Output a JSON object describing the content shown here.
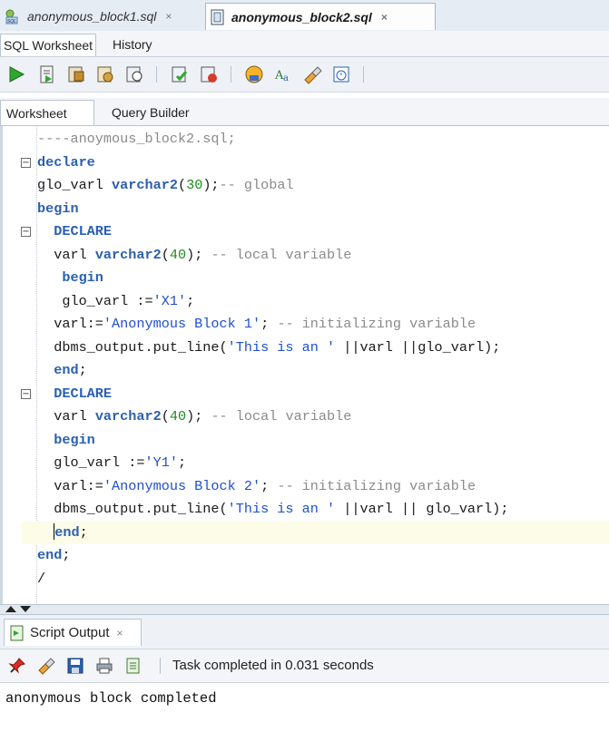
{
  "file_tabs": [
    {
      "label": "anonymous_block1.sql",
      "close": "×",
      "active": false
    },
    {
      "label": "anonymous_block2.sql",
      "close": "×",
      "active": true
    }
  ],
  "sub_tabs": {
    "worksheet": "SQL Worksheet",
    "history": "History"
  },
  "toolbar_icons": [
    "run-statement-icon",
    "run-script-icon",
    "autotrace-icon",
    "explain-plan-icon",
    "sql-tuning-icon",
    "commit-icon",
    "rollback-icon",
    "unshared-sql-icon",
    "to-upper-icon",
    "clear-icon",
    "sql-history-icon"
  ],
  "worksheet_tabs": {
    "worksheet": "Worksheet",
    "query_builder": "Query Builder"
  },
  "editor": {
    "lines": [
      [
        {
          "t": "----anoymous_block2.sql;",
          "c": "cm"
        }
      ],
      [
        {
          "t": "declare",
          "c": "kw"
        }
      ],
      [
        {
          "t": "glo_varl ",
          "c": ""
        },
        {
          "t": "varchar2",
          "c": "ty"
        },
        {
          "t": "(",
          "c": ""
        },
        {
          "t": "30",
          "c": "nm"
        },
        {
          "t": ");",
          "c": ""
        },
        {
          "t": "-- global",
          "c": "cm"
        }
      ],
      [
        {
          "t": "begin",
          "c": "kw"
        }
      ],
      [
        {
          "t": "  DECLARE",
          "c": "kw"
        }
      ],
      [
        {
          "t": "  varl ",
          "c": ""
        },
        {
          "t": "varchar2",
          "c": "ty"
        },
        {
          "t": "(",
          "c": ""
        },
        {
          "t": "40",
          "c": "nm"
        },
        {
          "t": "); ",
          "c": ""
        },
        {
          "t": "-- local variable",
          "c": "cm"
        }
      ],
      [
        {
          "t": "   begin",
          "c": "kw"
        }
      ],
      [
        {
          "t": "   glo_varl :=",
          "c": ""
        },
        {
          "t": "'X1'",
          "c": "st"
        },
        {
          "t": ";",
          "c": ""
        }
      ],
      [
        {
          "t": "  varl:=",
          "c": ""
        },
        {
          "t": "'Anonymous Block 1'",
          "c": "st"
        },
        {
          "t": "; ",
          "c": ""
        },
        {
          "t": "-- initializing variable",
          "c": "cm"
        }
      ],
      [
        {
          "t": "  dbms_output.put_line(",
          "c": ""
        },
        {
          "t": "'This is an '",
          "c": "st"
        },
        {
          "t": " ||varl ||glo_varl);",
          "c": ""
        }
      ],
      [
        {
          "t": "  end",
          "c": "kw"
        },
        {
          "t": ";",
          "c": ""
        }
      ],
      [
        {
          "t": "  DECLARE",
          "c": "kw"
        }
      ],
      [
        {
          "t": "  varl ",
          "c": ""
        },
        {
          "t": "varchar2",
          "c": "ty"
        },
        {
          "t": "(",
          "c": ""
        },
        {
          "t": "40",
          "c": "nm"
        },
        {
          "t": "); ",
          "c": ""
        },
        {
          "t": "-- local variable",
          "c": "cm"
        }
      ],
      [
        {
          "t": "  begin",
          "c": "kw"
        }
      ],
      [
        {
          "t": "  glo_varl :=",
          "c": ""
        },
        {
          "t": "'Y1'",
          "c": "st"
        },
        {
          "t": ";",
          "c": ""
        }
      ],
      [
        {
          "t": "  varl:=",
          "c": ""
        },
        {
          "t": "'Anonymous Block 2'",
          "c": "st"
        },
        {
          "t": "; ",
          "c": ""
        },
        {
          "t": "-- initializing variable",
          "c": "cm"
        }
      ],
      [
        {
          "t": "  dbms_output.put_line(",
          "c": ""
        },
        {
          "t": "'This is an '",
          "c": "st"
        },
        {
          "t": " ||varl || glo_varl);",
          "c": ""
        }
      ],
      [
        {
          "t": "  end",
          "c": "kw"
        },
        {
          "t": ";",
          "c": ""
        }
      ],
      [
        {
          "t": "end",
          "c": "kw"
        },
        {
          "t": ";",
          "c": ""
        }
      ],
      [
        {
          "t": "/",
          "c": ""
        }
      ]
    ],
    "fold_markers": [
      1,
      4,
      11
    ],
    "current_line": 17
  },
  "output": {
    "tab_label": "Script Output",
    "tab_close": "×",
    "status": "Task completed in 0.031 seconds",
    "text": "anonymous block completed"
  },
  "colors": {
    "keyword": "#2b5fb0",
    "string": "#1f4fcc",
    "number": "#1e8a1e",
    "comment": "#8a8a8a",
    "current_line": "#fcfce8"
  }
}
